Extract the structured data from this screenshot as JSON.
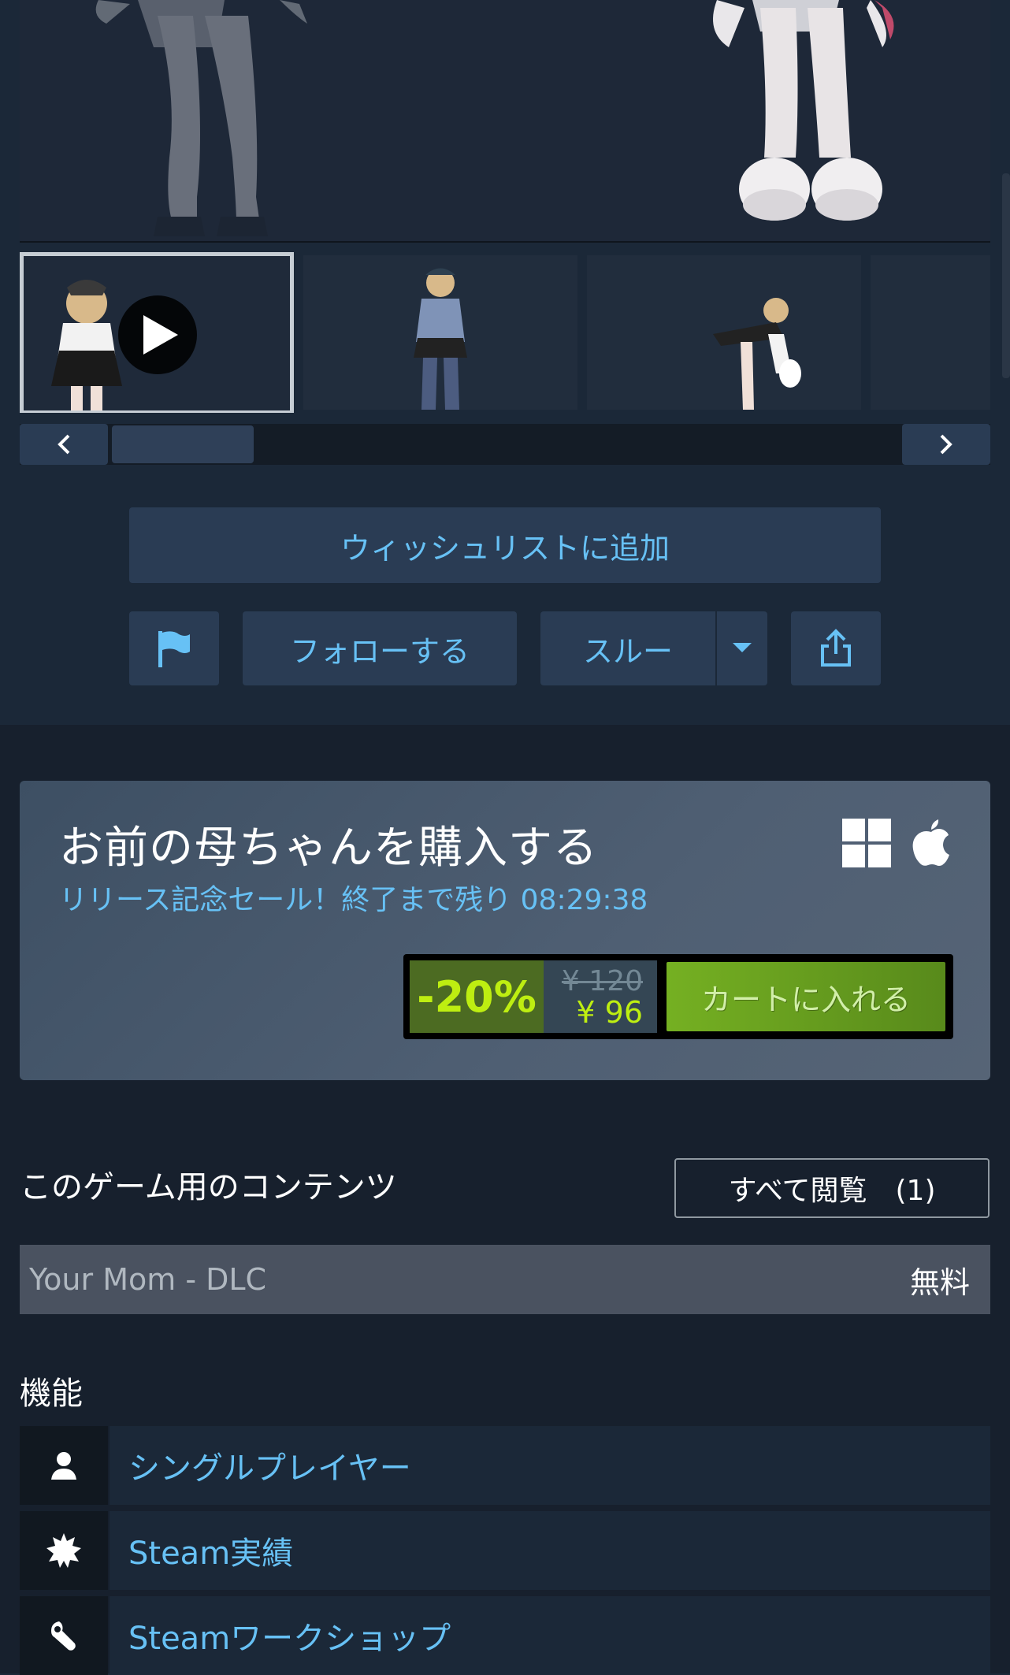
{
  "media": {
    "thumbnails": [
      {
        "kind": "video"
      },
      {
        "kind": "image"
      },
      {
        "kind": "image"
      },
      {
        "kind": "image"
      }
    ]
  },
  "actions": {
    "wishlist_label": "ウィッシュリストに追加",
    "follow_label": "フォローする",
    "ignore_label": "スルー"
  },
  "purchase": {
    "title": "お前の母ちゃんを購入する",
    "sale_text": "リリース記念セール！終了まで残り 08:29:38",
    "discount": "-20%",
    "original_price": "¥ 120",
    "final_price": "¥ 96",
    "cart_label": "カートに入れる",
    "platforms": [
      "windows-icon",
      "apple-icon"
    ]
  },
  "dlc": {
    "heading": "このゲーム用のコンテンツ",
    "browse_label": "すべて閲覧　(1)",
    "items": [
      {
        "name": "Your Mom - DLC",
        "price": "無料"
      }
    ]
  },
  "features": {
    "heading": "機能",
    "items": [
      {
        "icon": "single-player-icon",
        "label": "シングルプレイヤー"
      },
      {
        "icon": "achievements-icon",
        "label": "Steam実績"
      },
      {
        "icon": "workshop-icon",
        "label": "Steamワークショップ"
      }
    ]
  },
  "colors": {
    "accent_blue": "#67c1f5",
    "discount_green": "#beee11",
    "cart_green": "#75b022",
    "background": "#1b2838"
  }
}
